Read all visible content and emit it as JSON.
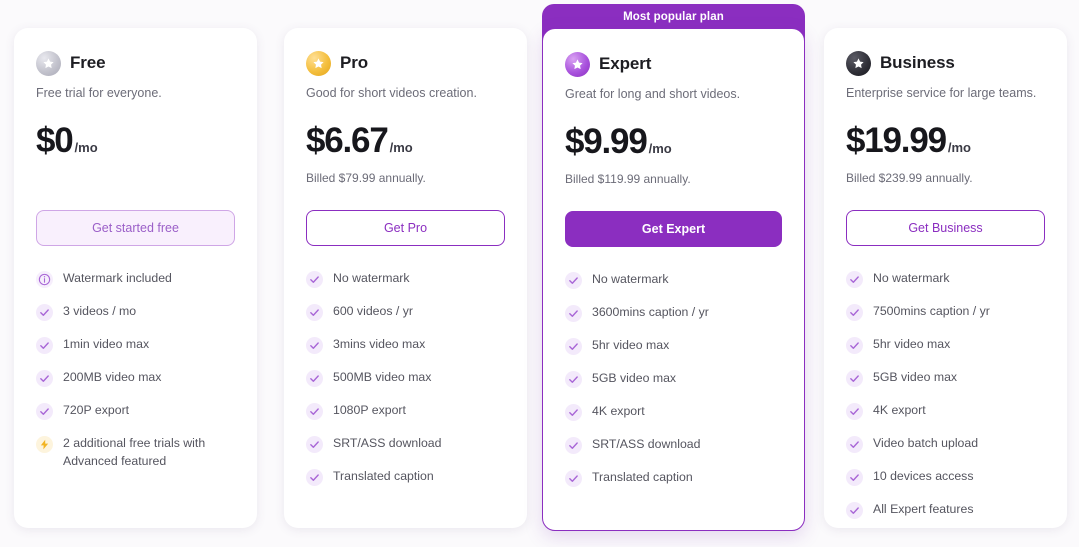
{
  "plans": [
    {
      "id": "free",
      "name": "Free",
      "tagline": "Free trial for everyone.",
      "price": "$0",
      "period": "/mo",
      "billed": "",
      "badge_icon": "star-badge-icon",
      "cta_label": "Get started free",
      "banner": "",
      "features": [
        {
          "icon": "info-icon",
          "label": "Watermark included"
        },
        {
          "icon": "check-icon",
          "label": "3 videos / mo"
        },
        {
          "icon": "check-icon",
          "label": "1min video max"
        },
        {
          "icon": "check-icon",
          "label": "200MB video max"
        },
        {
          "icon": "check-icon",
          "label": "720P export"
        },
        {
          "icon": "bolt-icon",
          "label": "2 additional free trials with Advanced featured"
        }
      ]
    },
    {
      "id": "pro",
      "name": "Pro",
      "tagline": "Good for short videos creation.",
      "price": "$6.67",
      "period": "/mo",
      "billed": "Billed $79.99 annually.",
      "badge_icon": "star-badge-icon",
      "cta_label": "Get Pro",
      "banner": "",
      "features": [
        {
          "icon": "check-icon",
          "label": "No watermark"
        },
        {
          "icon": "check-icon",
          "label": "600 videos / yr"
        },
        {
          "icon": "check-icon",
          "label": "3mins video max"
        },
        {
          "icon": "check-icon",
          "label": "500MB video max"
        },
        {
          "icon": "check-icon",
          "label": "1080P export"
        },
        {
          "icon": "check-icon",
          "label": "SRT/ASS download"
        },
        {
          "icon": "check-icon",
          "label": "Translated caption"
        }
      ]
    },
    {
      "id": "expert",
      "name": "Expert",
      "tagline": "Great for long and short videos.",
      "price": "$9.99",
      "period": "/mo",
      "billed": "Billed $119.99 annually.",
      "badge_icon": "star-badge-icon",
      "cta_label": "Get Expert",
      "banner": "Most popular plan",
      "features": [
        {
          "icon": "check-icon",
          "label": "No watermark"
        },
        {
          "icon": "check-icon",
          "label": "3600mins caption / yr"
        },
        {
          "icon": "check-icon",
          "label": "5hr video max"
        },
        {
          "icon": "check-icon",
          "label": "5GB video max"
        },
        {
          "icon": "check-icon",
          "label": "4K export"
        },
        {
          "icon": "check-icon",
          "label": "SRT/ASS download"
        },
        {
          "icon": "check-icon",
          "label": "Translated caption"
        }
      ]
    },
    {
      "id": "business",
      "name": "Business",
      "tagline": "Enterprise service for large teams.",
      "price": "$19.99",
      "period": "/mo",
      "billed": "Billed $239.99 annually.",
      "badge_icon": "star-badge-icon",
      "cta_label": "Get Business",
      "banner": "",
      "features": [
        {
          "icon": "check-icon",
          "label": "No watermark"
        },
        {
          "icon": "check-icon",
          "label": "7500mins caption / yr"
        },
        {
          "icon": "check-icon",
          "label": "5hr video max"
        },
        {
          "icon": "check-icon",
          "label": "5GB video max"
        },
        {
          "icon": "check-icon",
          "label": "4K export"
        },
        {
          "icon": "check-icon",
          "label": "Video batch upload"
        },
        {
          "icon": "check-icon",
          "label": "10 devices access"
        },
        {
          "icon": "check-icon",
          "label": "All Expert features"
        }
      ]
    }
  ],
  "colors": {
    "accent": "#8b2ec0",
    "accent_tint": "#f9f0fd",
    "page_bg": "#fbfafc",
    "card_bg": "#ffffff",
    "text_primary": "#17171c",
    "text_secondary": "#6c6c78",
    "bolt_amber": "#f2b422"
  }
}
